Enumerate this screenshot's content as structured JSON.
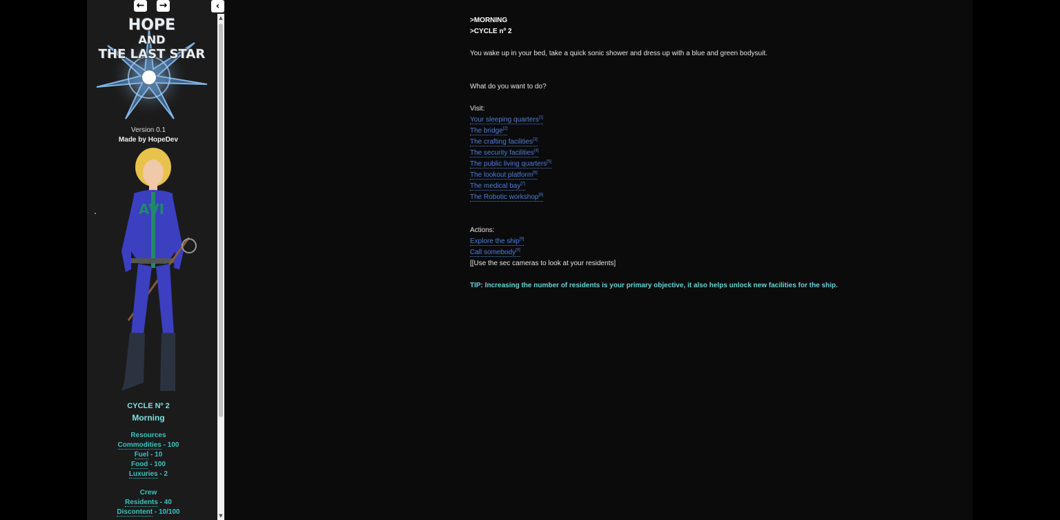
{
  "sidebar": {
    "logo_lines": [
      "HOPE",
      "AND",
      "THE LAST STAR"
    ],
    "version": "Version 0.1",
    "author": "Made by HopeDev",
    "cycle": "CYCLE Nº 2",
    "time_of_day": "Morning",
    "resources_heading": "Resources",
    "resources": [
      {
        "label": "Commodities",
        "value": " - 100"
      },
      {
        "label": "Fuel",
        "value": " - 10"
      },
      {
        "label": "Food",
        "value": " - 100"
      },
      {
        "label": "Luxuries",
        "value": " - 2"
      }
    ],
    "crew_heading": "Crew",
    "crew": [
      {
        "label": "Residents",
        "value": " - 40"
      },
      {
        "label": "Discontent",
        "value": " - 10/100"
      }
    ]
  },
  "main": {
    "header_lines": [
      ">MORNING",
      ">CYCLE nº 2"
    ],
    "intro": "You wake up in your bed, take a quick sonic shower and dress up with a blue and green bodysuit.",
    "question": "What do you want to do?",
    "visit_label": "Visit:",
    "visit_links": [
      {
        "label": "Your sleeping quarters",
        "key": "[1]"
      },
      {
        "label": "The bridge",
        "key": "[2]"
      },
      {
        "label": "The crafting facilities",
        "key": "[3]"
      },
      {
        "label": "The security facilities",
        "key": "[4]"
      },
      {
        "label": "The public living quarters",
        "key": "[5]"
      },
      {
        "label": "The lookout platform",
        "key": "[6]"
      },
      {
        "label": "The medical bay",
        "key": "[7]"
      },
      {
        "label": "The Robotic workshop",
        "key": "[8]"
      }
    ],
    "actions_label": "Actions:",
    "action_links": [
      {
        "label": "Explore the ship",
        "key": "[9]"
      },
      {
        "label": "Call somebody",
        "key": "[0]"
      }
    ],
    "camera_text": "[[Use the sec cameras to look at your residents]",
    "tip": "TIP: Increasing the number of residents is your primary objective, it also helps unlock new facilities for the ship."
  },
  "colors": {
    "accent_cyan": "#3fc1c1",
    "link_blue": "#4f7fd8",
    "tip_cyan": "#62d3d8",
    "sidebar_bg": "#1b1b1b"
  },
  "icons": [
    "arrow-left-icon",
    "arrow-right-icon",
    "collapse-left-icon"
  ]
}
